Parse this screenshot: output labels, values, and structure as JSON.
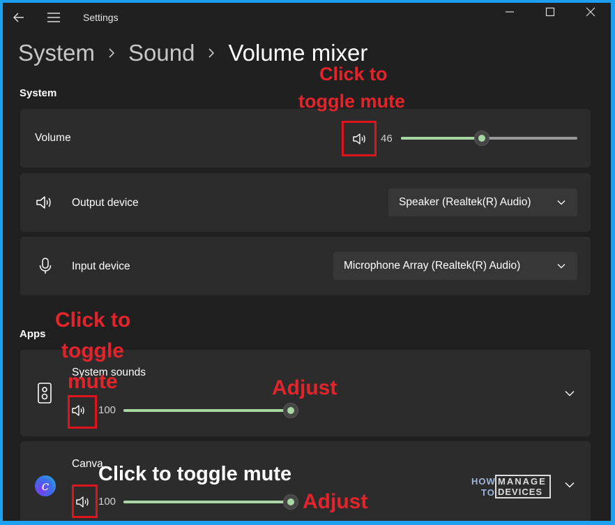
{
  "titlebar": {
    "title": "Settings"
  },
  "breadcrumb": {
    "items": [
      "System",
      "Sound",
      "Volume mixer"
    ]
  },
  "system": {
    "heading": "System",
    "volume": {
      "label": "Volume",
      "value": "46",
      "level": 0.46
    },
    "output_device": {
      "label": "Output device",
      "selected": "Speaker (Realtek(R) Audio)"
    },
    "input_device": {
      "label": "Input device",
      "selected": "Microphone Array (Realtek(R) Audio)"
    }
  },
  "apps": {
    "heading": "Apps",
    "items": [
      {
        "name": "System sounds",
        "value": "100",
        "level": 1.0
      },
      {
        "name": "Canva",
        "value": "100",
        "level": 1.0
      }
    ]
  },
  "annotations": {
    "system_mute_line1": "Click to",
    "system_mute_line2": "toggle mute",
    "sys_sounds_mute_line1": "Click to",
    "sys_sounds_mute_line2": "toggle",
    "sys_sounds_mute_line3": "mute",
    "sys_sounds_adjust": "Adjust",
    "canva_mute": "Click to toggle mute",
    "canva_adjust": "Adjust",
    "box_color": "#e0141d"
  },
  "watermark": {
    "how": "HOW",
    "to": "TO",
    "manage": "MANAGE",
    "devices": "DEVICES"
  },
  "colors": {
    "accent": "#a7d7a2",
    "background": "#202020",
    "card": "#2c2c2c",
    "frame": "#1ea0f0"
  },
  "icons": {
    "back": "back-arrow-icon",
    "menu": "hamburger-menu-icon",
    "minimize": "minimize-icon",
    "maximize": "maximize-icon",
    "close": "close-icon",
    "speaker": "speaker-icon",
    "microphone": "microphone-icon",
    "system_sounds": "system-sounds-icon",
    "canva": "canva-logo-icon",
    "chevron": "chevron-down-icon"
  }
}
